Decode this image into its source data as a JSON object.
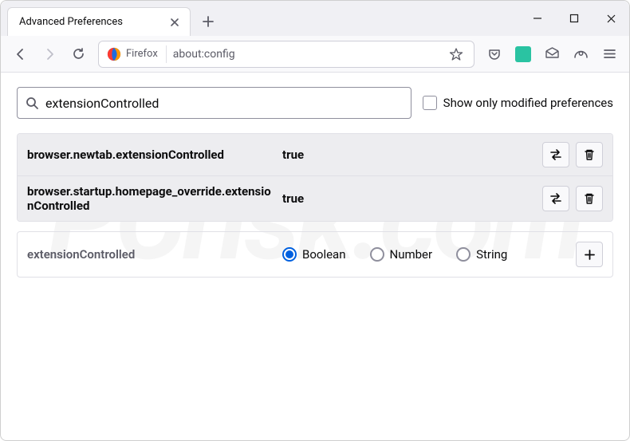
{
  "tab": {
    "title": "Advanced Preferences"
  },
  "urlbar": {
    "identity": "Firefox",
    "url": "about:config"
  },
  "search": {
    "value": "extensionControlled",
    "showModifiedLabel": "Show only modified preferences"
  },
  "prefs": [
    {
      "name": "browser.newtab.extensionControlled",
      "value": "true"
    },
    {
      "name": "browser.startup.homepage_override.extensionControlled",
      "value": "true"
    }
  ],
  "newPref": {
    "name": "extensionControlled",
    "types": [
      "Boolean",
      "Number",
      "String"
    ],
    "selected": "Boolean"
  },
  "watermark": "PCrisk.com"
}
